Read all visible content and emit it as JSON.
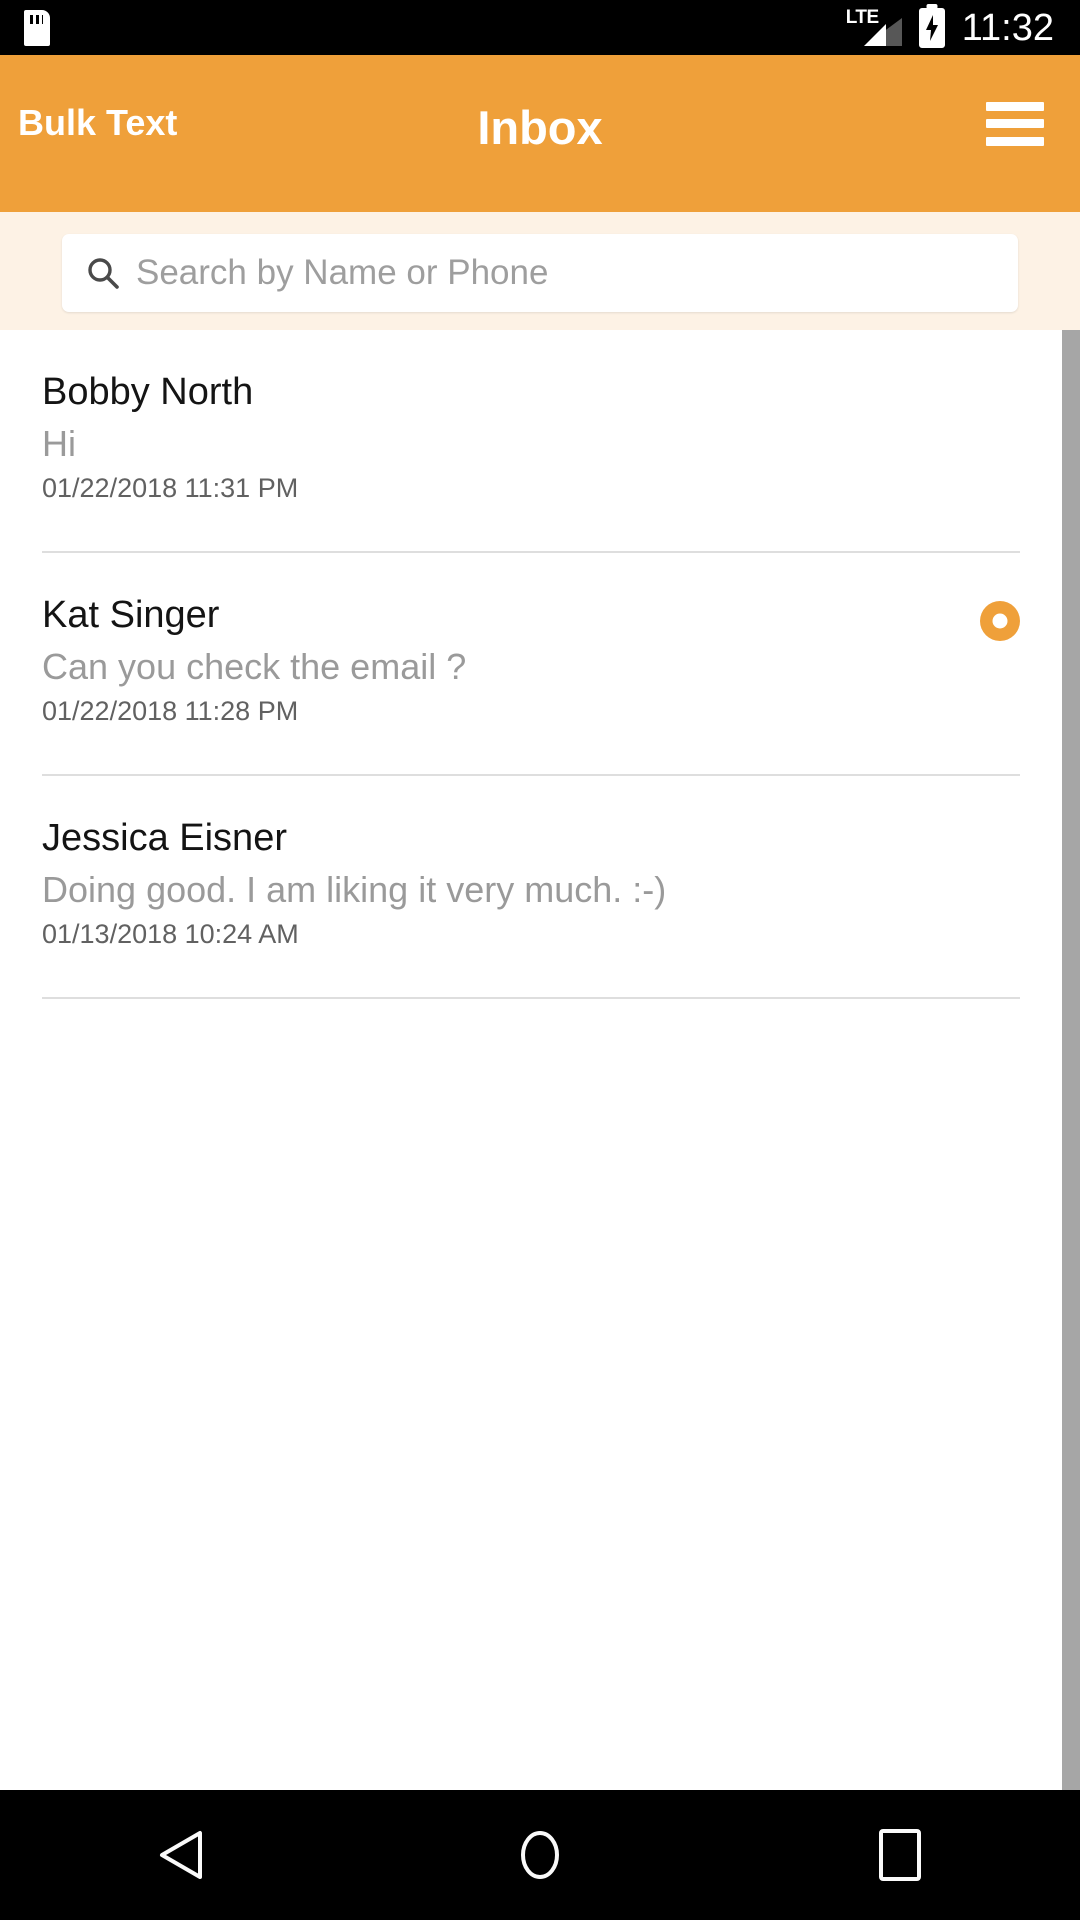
{
  "status_bar": {
    "sd_card_icon": "sd-card-icon",
    "network_label": "LTE",
    "signal_icon": "signal-bars-icon",
    "battery_icon": "battery-charging-icon",
    "clock": "11:32"
  },
  "app_bar": {
    "brand": "Bulk Text",
    "title": "Inbox",
    "menu_icon": "hamburger-menu-icon",
    "background_color": "#efa03a"
  },
  "search": {
    "icon": "search-icon",
    "value": "",
    "placeholder": "Search by Name or Phone",
    "zone_background_color": "#fdf2e5"
  },
  "messages": [
    {
      "name": "Bobby North",
      "preview": "Hi",
      "timestamp": "01/22/2018 11:31 PM",
      "unread": false
    },
    {
      "name": "Kat Singer",
      "preview": "Can you check the email ?",
      "timestamp": "01/22/2018 11:28 PM",
      "unread": true
    },
    {
      "name": "Jessica Eisner",
      "preview": "Doing good. I am liking it very much. :-)",
      "timestamp": "01/13/2018 10:24 AM",
      "unread": false
    }
  ],
  "unread_badge_color": "#efa03a",
  "nav_bar": {
    "back_icon": "back-triangle-icon",
    "home_icon": "home-circle-icon",
    "recents_icon": "recents-square-icon"
  }
}
